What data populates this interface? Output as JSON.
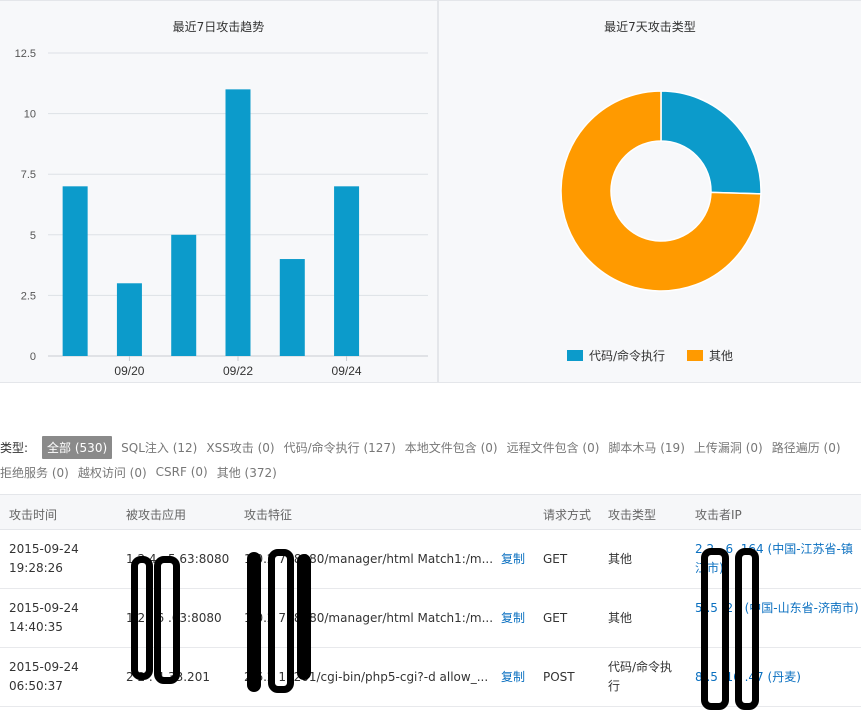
{
  "trend_panel": {
    "title": "最近7日攻击趋势"
  },
  "type_panel": {
    "title": "最近7天攻击类型"
  },
  "chart_data": [
    {
      "type": "bar",
      "title": "最近7日攻击趋势",
      "categories": [
        "",
        "09/20",
        "",
        "09/22",
        "",
        "09/24",
        ""
      ],
      "values": [
        7,
        3,
        5,
        11,
        4,
        7
      ],
      "yticks": [
        "0",
        "2.5",
        "5",
        "7.5",
        "10",
        "12.5"
      ],
      "ylim": [
        0,
        12.5
      ],
      "grid": true,
      "color": "#0c9bcb"
    },
    {
      "type": "pie",
      "title": "最近7天攻击类型",
      "donut": true,
      "slices": [
        {
          "name": "代码/命令执行",
          "value": 127,
          "color": "#0c9bcb"
        },
        {
          "name": "其他",
          "value": 372,
          "color": "#ff9a00"
        }
      ],
      "legend_position": "bottom"
    }
  ],
  "filters": {
    "label": "类型:",
    "row1": [
      {
        "text": "全部 (530)",
        "active": true
      },
      {
        "text": "SQL注入 (12)",
        "active": false
      },
      {
        "text": "XSS攻击 (0)",
        "active": false
      },
      {
        "text": "代码/命令执行 (127)",
        "active": false
      },
      {
        "text": "本地文件包含 (0)",
        "active": false
      },
      {
        "text": "远程文件包含 (0)",
        "active": false
      },
      {
        "text": "脚本木马 (19)",
        "active": false
      },
      {
        "text": "上传漏洞 (0)",
        "active": false
      },
      {
        "text": "路径遍历 (0)",
        "active": false
      }
    ],
    "row2": [
      {
        "text": "拒绝服务 (0)",
        "active": false
      },
      {
        "text": "越权访问 (0)",
        "active": false
      },
      {
        "text": "CSRF (0)",
        "active": false
      },
      {
        "text": "其他 (372)",
        "active": false
      }
    ]
  },
  "table": {
    "headers": {
      "time": "攻击时间",
      "app": "被攻击应用",
      "signature": "攻击特征",
      "method": "请求方式",
      "type": "攻击类型",
      "ip": "攻击者IP"
    },
    "copy_label": "复制",
    "rows": [
      {
        "time": "2015-09-24 19:28:26",
        "app": "1  2 4 . 5.63:8080",
        "signature": "1 0.2   7  :8080/manager/html Match1:/m...",
        "method": "GET",
        "type": "其他",
        "ip": "2 2 . 6  .164 (中国-江苏省-镇江市)"
      },
      {
        "time": "2015-09-24 14:40:35",
        "app": "1   2 . 6 .63:8080",
        "signature": "1 0.2   7  :8080/manager/html Match1:/m...",
        "method": "GET",
        "type": "其他",
        "ip": "5 .5 .2 .  (中国-山东省-济南市)"
      },
      {
        "time": "2015-09-24 06:50:37",
        "app": "2   2 . 4  33.201",
        "signature": "2 6.2  1 .201/cgi-bin/php5-cgi?-d allow_...",
        "method": "POST",
        "type": "代码/命令执行",
        "ip": "8 .5 .16  .47 (丹麦)"
      }
    ]
  }
}
